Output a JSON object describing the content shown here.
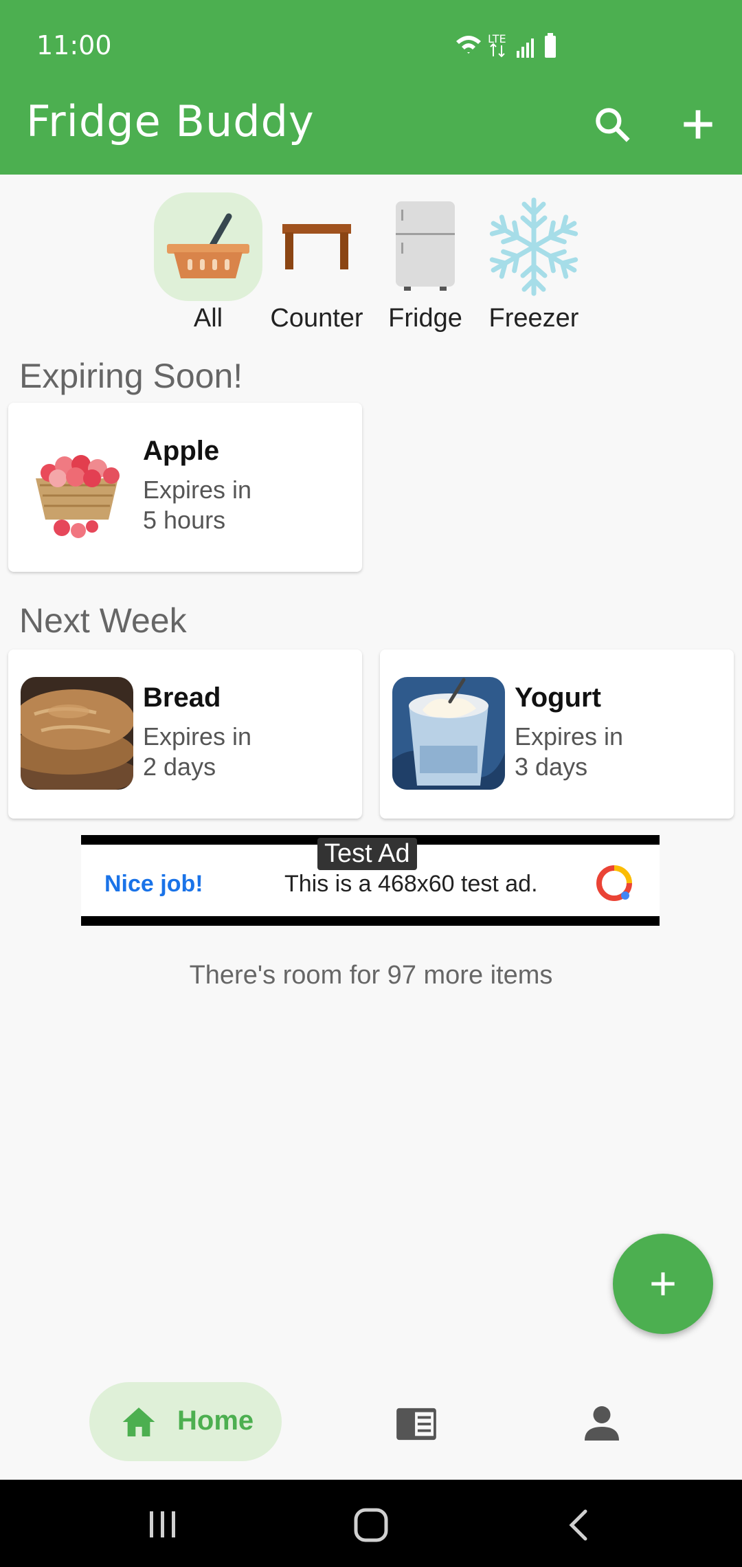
{
  "status_bar": {
    "time": "11:00",
    "network": "LTE"
  },
  "app_bar": {
    "title": "Fridge Buddy",
    "icons": [
      "search-icon",
      "plus-icon"
    ]
  },
  "filters": [
    {
      "label": "All",
      "icon": "basket-icon",
      "active": true
    },
    {
      "label": "Counter",
      "icon": "table-icon",
      "active": false
    },
    {
      "label": "Fridge",
      "icon": "fridge-icon",
      "active": false
    },
    {
      "label": "Freezer",
      "icon": "snowflake-icon",
      "active": false
    }
  ],
  "sections": [
    {
      "title": "Expiring Soon!",
      "items": [
        {
          "name": "Apple",
          "expires_line1": "Expires in",
          "expires_line2": "5 hours"
        }
      ]
    },
    {
      "title": "Next Week",
      "items": [
        {
          "name": "Bread",
          "expires_line1": "Expires in",
          "expires_line2": "2 days"
        },
        {
          "name": "Yogurt",
          "expires_line1": "Expires in",
          "expires_line2": "3 days"
        }
      ]
    }
  ],
  "ad": {
    "badge": "Test Ad",
    "headline": "Nice job!",
    "text": "This is a 468x60 test ad."
  },
  "room_text": "There's room for 97 more items",
  "fab": {
    "icon": "plus-icon"
  },
  "bottom_nav": {
    "home_label": "Home",
    "items": [
      "home-icon",
      "list-icon",
      "profile-icon"
    ]
  },
  "colors": {
    "primary": "#4caf50",
    "selected_bg": "#dff0d8"
  }
}
